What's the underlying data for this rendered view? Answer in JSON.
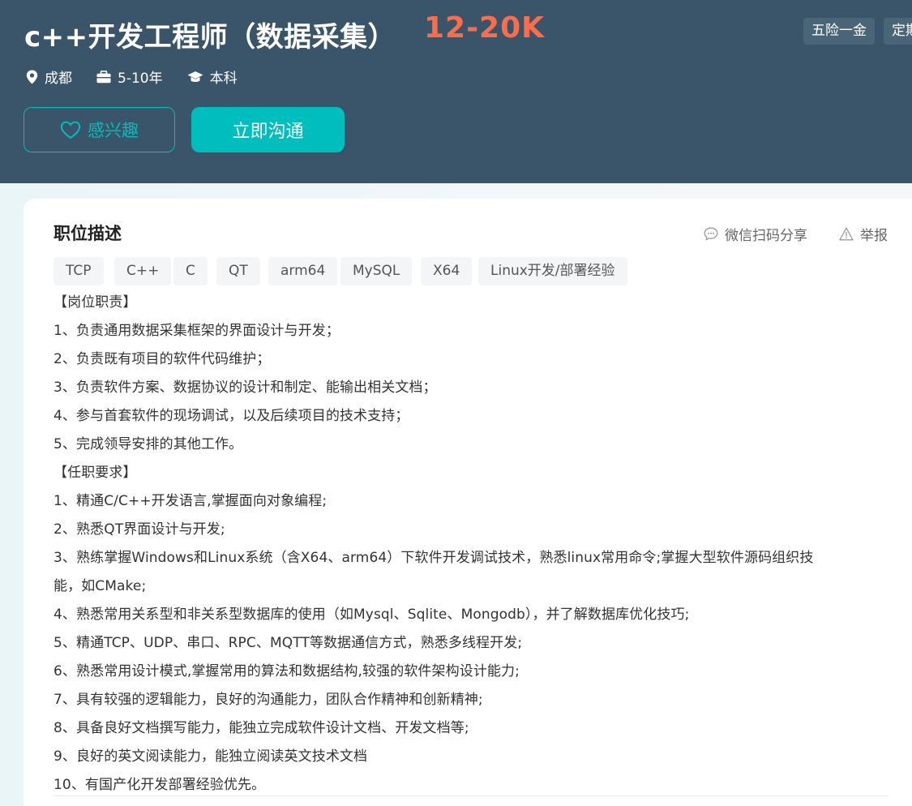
{
  "header": {
    "title": "c++开发工程师（数据采集）",
    "salary": "12-20K",
    "benefits": [
      "五险一金",
      "定期"
    ],
    "meta": {
      "location": "成都",
      "experience": "5-10年",
      "education": "本科"
    },
    "actions": {
      "interest_label": "感兴趣",
      "chat_label": "立即沟通"
    }
  },
  "description": {
    "section_title": "职位描述",
    "share_label": "微信扫码分享",
    "report_label": "举报",
    "skill_tags": [
      "TCP",
      "C++",
      "C",
      "QT",
      "arm64",
      "MySQL",
      "X64",
      "Linux开发/部署经验"
    ],
    "lines": [
      "【岗位职责】",
      "1、负责通用数据采集框架的界面设计与开发；",
      "2、负责既有项目的软件代码维护；",
      "3、负责软件方案、数据协议的设计和制定、能输出相关文档；",
      "4、参与首套软件的现场调试，以及后续项目的技术支持；",
      "5、完成领导安排的其他工作。",
      "【任职要求】",
      "1、精通C/C++开发语言,掌握面向对象编程;",
      "2、熟悉QT界面设计与开发;",
      "3、熟练掌握Windows和Linux系统（含X64、arm64）下软件开发调试技术，熟悉linux常用命令;掌握大型软件源码组织技",
      "能，如CMake;",
      "4、熟悉常用关系型和非关系型数据库的使用（如Mysql、Sqlite、Mongodb），并了解数据库优化技巧;",
      "5、精通TCP、UDP、串口、RPC、MQTT等数据通信方式，熟悉多线程开发;",
      "6、熟悉常用设计模式,掌握常用的算法和数据结构,较强的软件架构设计能力;",
      "7、具有较强的逻辑能力，良好的沟通能力，团队合作精神和创新精神;",
      "8、具备良好文档撰写能力，能独立完成软件设计文档、开发文档等;",
      "9、良好的英文阅读能力，能独立阅读英文技术文档",
      "10、有国产化开发部署经验优先。"
    ]
  },
  "colors": {
    "header_bg": "#3a5569",
    "salary": "#fd6d4c",
    "accent": "#00bebd"
  },
  "icons": {
    "location": "location-pin-icon",
    "experience": "briefcase-icon",
    "education": "graduation-cap-icon",
    "interest": "heart-outline-icon",
    "share": "chat-bubble-icon",
    "report": "warning-triangle-icon"
  }
}
